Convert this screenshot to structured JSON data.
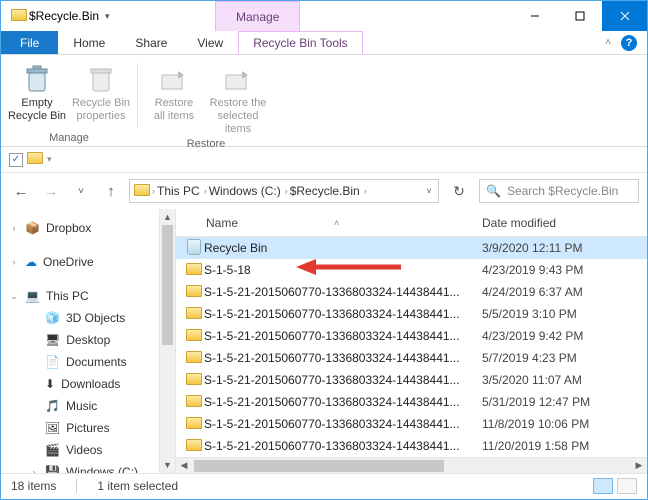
{
  "window": {
    "title": "$Recycle.Bin",
    "contextual_label": "Manage"
  },
  "tabs": {
    "file": "File",
    "home": "Home",
    "share": "Share",
    "view": "View",
    "ctx": "Recycle Bin Tools"
  },
  "ribbon": {
    "empty": "Empty\nRecycle Bin",
    "props": "Recycle Bin\nproperties",
    "restore_all": "Restore\nall items",
    "restore_sel": "Restore the\nselected items",
    "group_manage": "Manage",
    "group_restore": "Restore"
  },
  "breadcrumbs": [
    "This PC",
    "Windows (C:)",
    "$Recycle.Bin"
  ],
  "search_placeholder": "Search $Recycle.Bin",
  "nav": {
    "dropbox": "Dropbox",
    "onedrive": "OneDrive",
    "thispc": "This PC",
    "objects3d": "3D Objects",
    "desktop": "Desktop",
    "documents": "Documents",
    "downloads": "Downloads",
    "music": "Music",
    "pictures": "Pictures",
    "videos": "Videos",
    "windowsc": "Windows (C:)"
  },
  "columns": {
    "name": "Name",
    "date": "Date modified"
  },
  "files": [
    {
      "name": "Recycle Bin",
      "date": "3/9/2020 12:11 PM",
      "icon": "recycle",
      "selected": true
    },
    {
      "name": "S-1-5-18",
      "date": "4/23/2019 9:43 PM",
      "icon": "folder"
    },
    {
      "name": "S-1-5-21-2015060770-1336803324-14438441...",
      "date": "4/24/2019 6:37 AM",
      "icon": "folder"
    },
    {
      "name": "S-1-5-21-2015060770-1336803324-14438441...",
      "date": "5/5/2019 3:10 PM",
      "icon": "folder"
    },
    {
      "name": "S-1-5-21-2015060770-1336803324-14438441...",
      "date": "4/23/2019 9:42 PM",
      "icon": "folder"
    },
    {
      "name": "S-1-5-21-2015060770-1336803324-14438441...",
      "date": "5/7/2019 4:23 PM",
      "icon": "folder"
    },
    {
      "name": "S-1-5-21-2015060770-1336803324-14438441...",
      "date": "3/5/2020 11:07 AM",
      "icon": "folder"
    },
    {
      "name": "S-1-5-21-2015060770-1336803324-14438441...",
      "date": "5/31/2019 12:47 PM",
      "icon": "folder"
    },
    {
      "name": "S-1-5-21-2015060770-1336803324-14438441...",
      "date": "11/8/2019 10:06 PM",
      "icon": "folder"
    },
    {
      "name": "S-1-5-21-2015060770-1336803324-14438441...",
      "date": "11/20/2019 1:58 PM",
      "icon": "folder"
    }
  ],
  "status": {
    "count": "18 items",
    "selected": "1 item selected"
  }
}
